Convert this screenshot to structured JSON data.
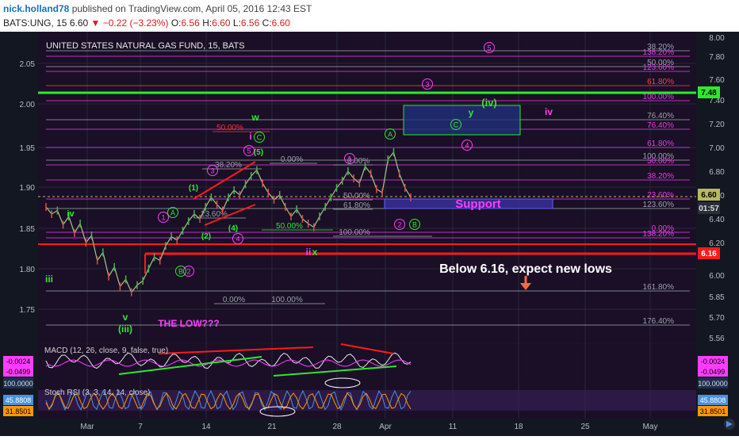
{
  "header": {
    "user": "nick.holland78",
    "published": "published on TradingView.com, April 05, 2016 12:43 EST",
    "symbol": "BATS:UNG, 15",
    "last": "6.60",
    "change": "−0.22 (−3.23%)",
    "o": "6.56",
    "h": "6.60",
    "l": "6.56",
    "c": "6.60"
  },
  "colors": {
    "bg": "#131722",
    "green": "#2ee82e",
    "red": "#ff1a1a",
    "magenta": "#ff3dff",
    "fib": "#9aa0aa"
  },
  "chart_data": {
    "type": "line",
    "title": "UNITED STATES NATURAL GAS FUND, 15, BATS",
    "x_ticks": [
      "Mar",
      "7",
      "14",
      "21",
      "28",
      "Apr",
      "11",
      "18",
      "25",
      "May"
    ],
    "left_ticks": [
      "2.05",
      "2.00",
      "1.95",
      "1.90",
      "1.85",
      "1.80",
      "1.75"
    ],
    "right_ticks": [
      "8.00",
      "7.80",
      "7.60",
      "7.40",
      "7.20",
      "7.00",
      "6.80",
      "6.60",
      "6.40",
      "6.20",
      "6.00",
      "5.85",
      "5.70",
      "5.56"
    ],
    "price_tags": [
      "7.48",
      "6.60",
      "01:57",
      "6.16"
    ],
    "series": [
      {
        "values": [
          6.5,
          6.44,
          6.47,
          6.35,
          6.42,
          6.28,
          6.36,
          6.2,
          6.26,
          6.09,
          6.14,
          5.99,
          6.05,
          5.92,
          5.97,
          5.88,
          5.93,
          5.96,
          6.04,
          6.11,
          6.09,
          6.18,
          6.25,
          6.22,
          6.3,
          6.38,
          6.44,
          6.4,
          6.5,
          6.58,
          6.52,
          6.47,
          6.58,
          6.64,
          6.6,
          6.69,
          6.76,
          6.81,
          6.7,
          6.62,
          6.56,
          6.6,
          6.5,
          6.42,
          6.48,
          6.4,
          6.36,
          6.33,
          6.42,
          6.5,
          6.58,
          6.66,
          6.72,
          6.8,
          6.74,
          6.7,
          6.84,
          6.78,
          6.65,
          6.62,
          6.9,
          6.96,
          6.78,
          6.66,
          6.58
        ]
      }
    ],
    "fib_labels": [
      "38.20%",
      "138.20%",
      "50.00%",
      "123.60%",
      "61.80%",
      "100.00%",
      "76.40%",
      "76.40%",
      "61.80%",
      "100.00%",
      "50.00%",
      "38.20%",
      "23.60%",
      "123.60%",
      "0.00%",
      "138.20%",
      "161.80%",
      "176.40%",
      "50.00%",
      "0.00%",
      "0.00%",
      "38.20%",
      "23.60%",
      "50.00%",
      "61.80%",
      "50.00%",
      "100.00%",
      "0.00%",
      "100.00%"
    ],
    "annotations": [
      "iv",
      "iii",
      "v",
      "(iii)",
      "THE LOW???",
      "w",
      "i",
      "x",
      "ii",
      "(iv)",
      "y",
      "iv",
      "Support",
      "Below 6.16, expect new lows",
      "(1)",
      "(2)",
      "(4)",
      "(5)",
      "1",
      "2",
      "3",
      "4",
      "5",
      "A",
      "B",
      "C",
      "C"
    ],
    "macd_label": "MACD (12, 26, close, 9, false, true)",
    "macd_values": [
      "-0.0024",
      "-0.0499"
    ],
    "stoch_label": "Stoch RSI (3, 3, 14, 14, close)",
    "stoch_values": [
      "100.0000",
      "45.8808",
      "31.8501"
    ],
    "grid": true,
    "legend": "none"
  }
}
